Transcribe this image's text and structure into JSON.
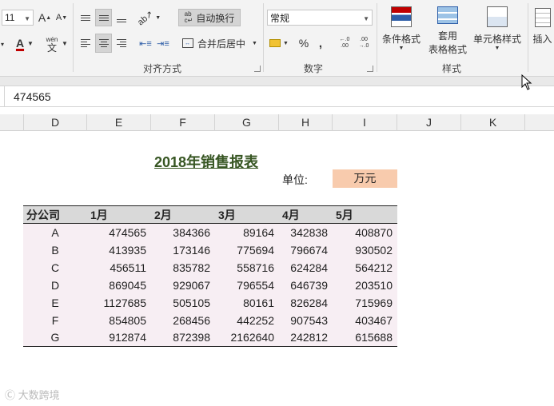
{
  "ribbon": {
    "font_size": "11",
    "font_grow_label": "A",
    "font_shrink_label": "A",
    "wen_label": "wén",
    "wen_char": "文",
    "font_color_label": "A",
    "wrap_text_label": "自动换行",
    "merge_center_label": "合并后居中",
    "align_group_label": "对齐方式",
    "number_format": "常规",
    "percent_label": "%",
    "comma_label": ",",
    "dec_increase_label": "←.0 .00",
    "dec_decrease_label": ".00 →.0",
    "number_group_label": "数字",
    "cond_format_label": "条件格式",
    "table_format_label1": "套用",
    "table_format_label2": "表格格式",
    "cell_styles_label": "单元格样式",
    "styles_group_label": "样式",
    "insert_label": "插入"
  },
  "formula_bar": {
    "value": "474565"
  },
  "columns": [
    "D",
    "E",
    "F",
    "G",
    "H",
    "I",
    "J",
    "K"
  ],
  "sheet": {
    "title": "2018年销售报表",
    "unit_label": "单位:",
    "unit_value": "万元",
    "headers": [
      "分公司",
      "1月",
      "2月",
      "3月",
      "4月",
      "5月"
    ],
    "rows": [
      {
        "name": "A",
        "values": [
          "474565",
          "384366",
          "89164",
          "342838",
          "408870"
        ]
      },
      {
        "name": "B",
        "values": [
          "413935",
          "173146",
          "775694",
          "796674",
          "930502"
        ]
      },
      {
        "name": "C",
        "values": [
          "456511",
          "835782",
          "558716",
          "624284",
          "564212"
        ]
      },
      {
        "name": "D",
        "values": [
          "869045",
          "929067",
          "796554",
          "646739",
          "203510"
        ]
      },
      {
        "name": "E",
        "values": [
          "1127685",
          "505105",
          "80161",
          "826284",
          "715969"
        ]
      },
      {
        "name": "F",
        "values": [
          "854805",
          "268456",
          "442252",
          "907543",
          "403467"
        ]
      },
      {
        "name": "G",
        "values": [
          "912874",
          "872398",
          "2162640",
          "242812",
          "615688"
        ]
      }
    ]
  },
  "watermark": "大数跨境",
  "colors": {
    "title": "#375623",
    "unit_fill": "#f8cbad",
    "row_fill": "#f7eef3",
    "header_fill": "#d9d9d9"
  }
}
